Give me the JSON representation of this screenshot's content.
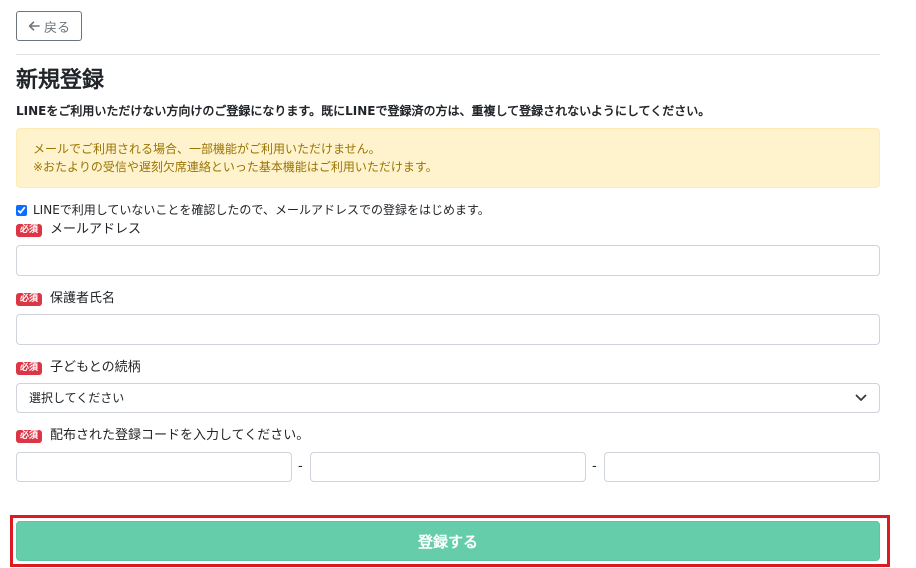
{
  "header": {
    "back_label": "戻る",
    "back_icon": "arrow-left-icon"
  },
  "main": {
    "title": "新規登録",
    "notice": "LINEをご利用いただけない方向けのご登録になります。既にLINEで登録済の方は、重複して登録されないようにしてください。",
    "alert": {
      "line1": "メールでご利用される場合、一部機能がご利用いただけません。",
      "line2": "※おたよりの受信や遅刻欠席連絡といった基本機能はご利用いただけます。"
    },
    "confirm_checkbox": {
      "label": "LINEで利用していないことを確認したので、メールアドレスでの登録をはじめます。",
      "checked": true
    }
  },
  "form": {
    "required_badge": "必須",
    "email": {
      "label": "メールアドレス",
      "value": "",
      "placeholder": ""
    },
    "guardian_name": {
      "label": "保護者氏名",
      "value": "",
      "placeholder": ""
    },
    "relation": {
      "label": "子どもとの続柄",
      "selected": "選択してください",
      "icon": "chevron-down-icon"
    },
    "registration_code": {
      "label": "配布された登録コードを入力してください。",
      "separator": "-",
      "parts": [
        "",
        "",
        ""
      ]
    },
    "submit_label": "登録する"
  },
  "colors": {
    "required_badge": "#dc3545",
    "alert_background": "#fff3cd",
    "alert_text": "#997404",
    "submit_button": "#66cdaa",
    "highlight_frame": "#dc1a22"
  }
}
